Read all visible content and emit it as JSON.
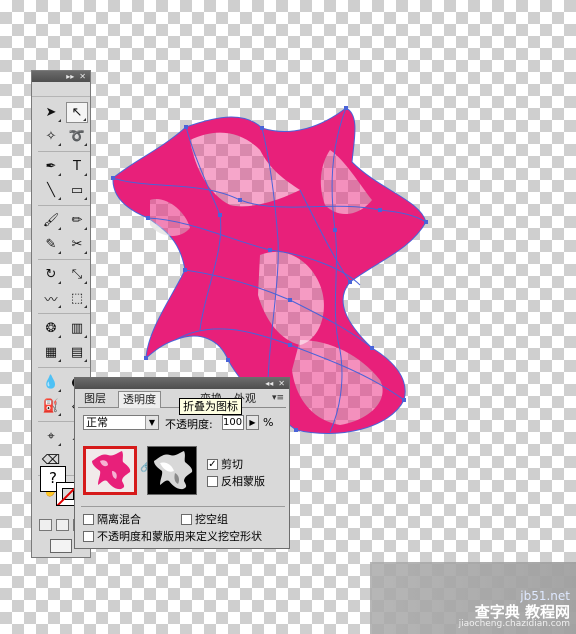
{
  "tools_panel": {
    "title_buttons": [
      "▸▸",
      "✕"
    ],
    "tools": [
      {
        "name": "selection-tool-icon",
        "glyph": "➤"
      },
      {
        "name": "direct-selection-tool-icon",
        "glyph": "↖"
      },
      {
        "name": "magic-wand-tool-icon",
        "glyph": "✧"
      },
      {
        "name": "lasso-tool-icon",
        "glyph": "➰"
      },
      {
        "name": "pen-tool-icon",
        "glyph": "✒"
      },
      {
        "name": "type-tool-icon",
        "glyph": "T"
      },
      {
        "name": "line-segment-tool-icon",
        "glyph": "╲"
      },
      {
        "name": "rectangle-tool-icon",
        "glyph": "▭"
      },
      {
        "name": "paintbrush-tool-icon",
        "glyph": "🖌"
      },
      {
        "name": "pencil-tool-icon",
        "glyph": "✏"
      },
      {
        "name": "blob-brush-tool-icon",
        "glyph": "✎"
      },
      {
        "name": "scissors-tool-icon",
        "glyph": "✂"
      },
      {
        "name": "rotate-tool-icon",
        "glyph": "↻"
      },
      {
        "name": "scale-tool-icon",
        "glyph": "⤡"
      },
      {
        "name": "warp-tool-icon",
        "glyph": "〰"
      },
      {
        "name": "free-transform-tool-icon",
        "glyph": "⬚"
      },
      {
        "name": "symbol-sprayer-tool-icon",
        "glyph": "❂"
      },
      {
        "name": "column-graph-tool-icon",
        "glyph": "▥"
      },
      {
        "name": "mesh-tool-icon",
        "glyph": "▦"
      },
      {
        "name": "gradient-tool-icon",
        "glyph": "▤"
      },
      {
        "name": "eyedropper-tool-icon",
        "glyph": "💧"
      },
      {
        "name": "blend-tool-icon",
        "glyph": "◐"
      },
      {
        "name": "live-paint-bucket-tool-icon",
        "glyph": "⛽"
      },
      {
        "name": "live-paint-selection-tool-icon",
        "glyph": "⬙"
      },
      {
        "name": "artboard-tool-icon",
        "glyph": "⌖"
      },
      {
        "name": "slice-tool-icon",
        "glyph": "⟋"
      },
      {
        "name": "eraser-tool-icon",
        "glyph": "⌫"
      },
      {
        "name": "knife-tool-icon",
        "glyph": "⌇"
      },
      {
        "name": "hand-tool-icon",
        "glyph": "✋"
      },
      {
        "name": "zoom-tool-icon",
        "glyph": "🔍"
      }
    ],
    "fill_glyph": "?"
  },
  "transparency_panel": {
    "title_buttons": [
      "◂◂",
      "✕"
    ],
    "tabs": {
      "layers": "图层",
      "transparency": "透明度",
      "transform": "变换",
      "appearance": "外观"
    },
    "menu_icon": "▾≡",
    "tooltip": "折叠为图标",
    "blend_mode": "正常",
    "opacity_label": "不透明度:",
    "opacity_value": "100",
    "opacity_unit": "%",
    "clip_label": "剪切",
    "clip_checked": "✓",
    "invert_mask_label": "反相蒙版",
    "isolate_blending_label": "隔离混合",
    "knockout_group_label": "挖空组",
    "opacity_mask_label": "不透明度和蒙版用来定义挖空形状"
  },
  "watermark": {
    "site": "jb51.net",
    "main": "查字典 教程网",
    "sub": "jiaocheng.chazidian.com"
  },
  "colors": {
    "shape_fill": "#e8207a",
    "path_stroke": "#4a63d8",
    "selected_thumb_border": "#d61a1a"
  }
}
